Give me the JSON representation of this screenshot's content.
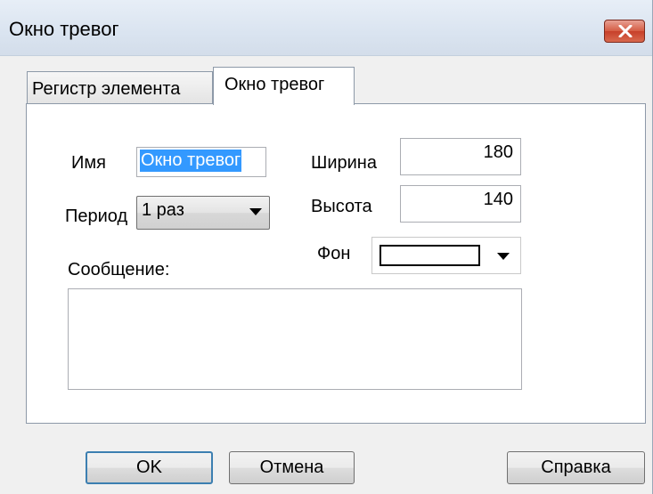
{
  "window": {
    "title": "Окно тревог"
  },
  "tabs": [
    {
      "label": "Регистр элемента",
      "active": false
    },
    {
      "label": "Окно тревог",
      "active": true
    }
  ],
  "form": {
    "name_label": "Имя",
    "name_value": "Окно тревог",
    "period_label": "Период",
    "period_value": "1 раз",
    "message_label": "Сообщение:",
    "message_value": "",
    "width_label": "Ширина",
    "width_value": "180",
    "height_label": "Высота",
    "height_value": "140",
    "background_label": "Фон",
    "background_color": "#ffffff"
  },
  "buttons": {
    "ok": "OK",
    "cancel": "Отмена",
    "help": "Справка"
  },
  "colors": {
    "selection": "#3399ff",
    "close_button": "#c7402a",
    "default_button_border": "#3c7fb1"
  },
  "icons": {
    "close": "close-icon",
    "dropdown": "chevron-down-icon"
  }
}
